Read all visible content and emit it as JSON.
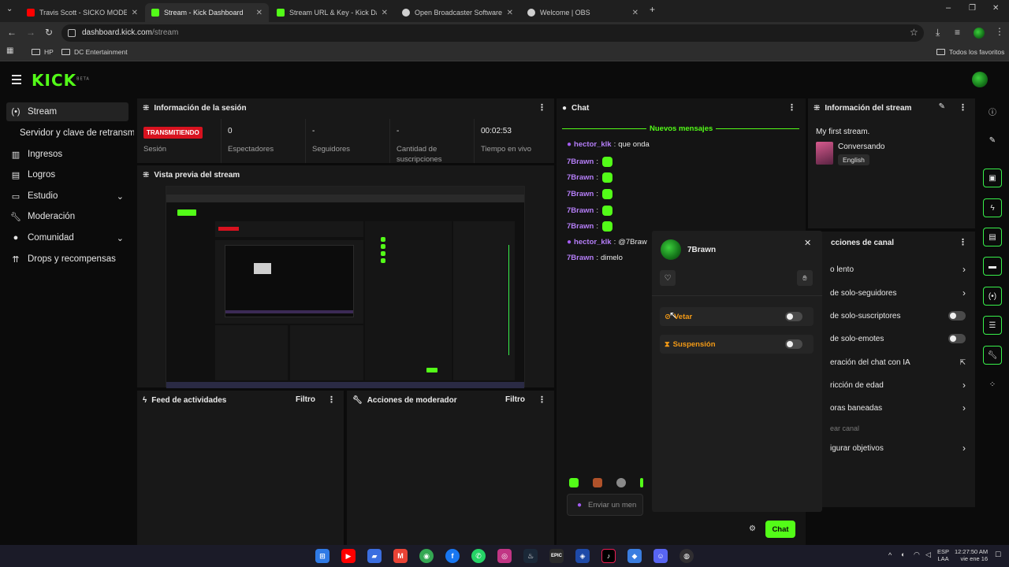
{
  "browser": {
    "tabs": [
      {
        "title": "Travis Scott - SICKO MODE (Offi",
        "color": "#ff0000",
        "active": false
      },
      {
        "title": "Stream - Kick Dashboard",
        "color": "#53fc18",
        "active": true
      },
      {
        "title": "Stream URL & Key - Kick Dashb",
        "color": "#53fc18",
        "active": false
      },
      {
        "title": "Open Broadcaster Software | OB",
        "color": "#cfcfcf",
        "active": false
      },
      {
        "title": "Welcome | OBS",
        "color": "#cfcfcf",
        "active": false
      }
    ],
    "url_host": "dashboard.kick.com",
    "url_path": "/stream",
    "bookmarks": [
      "HP",
      "DC Entertainment"
    ],
    "all_favorites": "Todos los favoritos"
  },
  "app": {
    "logo": "KICK",
    "logo_tag": "BETA",
    "accent": "#53fc18"
  },
  "sidebar": {
    "items": [
      {
        "label": "Stream",
        "icon": "broadcast-icon"
      },
      {
        "label": "Servidor y clave de retransmisión",
        "icon": ""
      },
      {
        "label": "Ingresos",
        "icon": "ingresos-icon"
      },
      {
        "label": "Logros",
        "icon": "trophy-icon"
      },
      {
        "label": "Estudio",
        "icon": "studio-icon"
      },
      {
        "label": "Moderación",
        "icon": "wrench-icon"
      },
      {
        "label": "Comunidad",
        "icon": "community-icon"
      },
      {
        "label": "Drops y recompensas",
        "icon": "drops-icon"
      }
    ]
  },
  "session": {
    "title": "Información de la sesión",
    "status_badge": "TRANSMITIENDO",
    "session_label": "Sesión",
    "viewers_value": "0",
    "viewers_label": "Espectadores",
    "followers_value": "-",
    "followers_label": "Seguidores",
    "subs_value": "-",
    "subs_label": "Cantidad de suscripciones",
    "live_time_value": "00:02:53",
    "live_time_label": "Tiempo en vivo"
  },
  "preview": {
    "title": "Vista previa del stream"
  },
  "activity": {
    "title": "Feed de actividades",
    "filter": "Filtro"
  },
  "modactions": {
    "title": "Acciones de moderador",
    "filter": "Filtro"
  },
  "chat": {
    "title": "Chat",
    "new_messages": "Nuevos mensajes",
    "messages": [
      {
        "user": "hector_klk",
        "text": "que onda",
        "mic": true
      },
      {
        "user": "7Brawn",
        "text": "",
        "emote": true
      },
      {
        "user": "7Brawn",
        "text": "",
        "emote": true
      },
      {
        "user": "7Brawn",
        "text": "",
        "emote": true
      },
      {
        "user": "7Brawn",
        "text": "",
        "emote": true
      },
      {
        "user": "7Brawn",
        "text": "",
        "emote": true
      },
      {
        "user": "hector_klk",
        "text": "@7Braw",
        "mic": true
      },
      {
        "user": "7Brawn",
        "text": "dimelo"
      }
    ],
    "input_placeholder": "Enviar un men",
    "send_button": "Chat"
  },
  "popup": {
    "username": "7Brawn",
    "ban_label": "Vetar",
    "timeout_label": "Suspensión"
  },
  "stream_info": {
    "title": "Información del stream",
    "stream_title": "My first stream.",
    "category": "Conversando",
    "language": "English"
  },
  "channel_actions": {
    "title": "cciones de canal",
    "items": [
      {
        "label": "o lento",
        "control": "chevron"
      },
      {
        "label": "de solo-seguidores",
        "control": "chevron"
      },
      {
        "label": "de solo-suscriptores",
        "control": "toggle"
      },
      {
        "label": "de solo-emotes",
        "control": "toggle"
      },
      {
        "label": "eración del chat con IA",
        "control": "external"
      },
      {
        "label": "ricción de edad",
        "control": "chevron"
      },
      {
        "label": "oras baneadas",
        "control": "chevron"
      },
      {
        "label": "ear canal",
        "control": "none"
      },
      {
        "label": "igurar objetivos",
        "control": "chevron"
      }
    ]
  },
  "taskbar": {
    "lang": "ESP",
    "region": "LAA",
    "time": "12:27:50 AM",
    "date": "vie ene 16"
  }
}
